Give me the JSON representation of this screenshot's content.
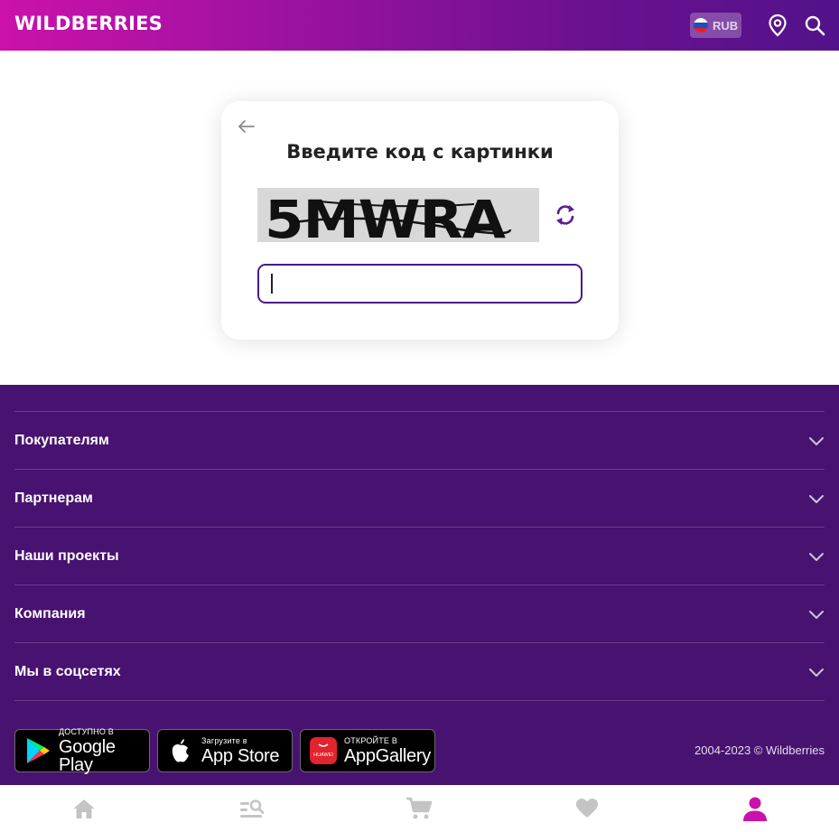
{
  "header": {
    "logo": "WILDBERRIES",
    "currency": "RUB",
    "icons": [
      "location-pin-icon",
      "search-icon"
    ]
  },
  "captcha": {
    "title": "Введите код с картинки",
    "image_text": "5MWRA",
    "input_value": "",
    "icons": [
      "back-arrow-icon",
      "refresh-icon"
    ]
  },
  "footer": {
    "sections": [
      {
        "label": "Покупателям"
      },
      {
        "label": "Партнерам"
      },
      {
        "label": "Наши проекты"
      },
      {
        "label": "Компания"
      },
      {
        "label": "Мы в соцсетях"
      }
    ],
    "stores": [
      {
        "small": "ДОСТУПНО В",
        "big": "Google Play",
        "icon": "google-play-icon"
      },
      {
        "small": "Загрузите в",
        "big": "App Store",
        "icon": "apple-icon"
      },
      {
        "small": "ОТКРОЙТЕ В",
        "big": "AppGallery",
        "icon": "huawei-icon",
        "icon_text": "HUAWEI"
      }
    ],
    "copyright": "2004-2023 © Wildberries"
  },
  "bottom_nav": {
    "items": [
      "home-icon",
      "catalog-search-icon",
      "cart-icon",
      "favorites-heart-icon",
      "profile-icon"
    ],
    "active": "profile-icon"
  },
  "colors": {
    "brand_magenta": "#cb11ab",
    "brand_purple": "#481270",
    "nav_inactive": "#c4c4c4",
    "nav_active": "#cb11ab"
  }
}
